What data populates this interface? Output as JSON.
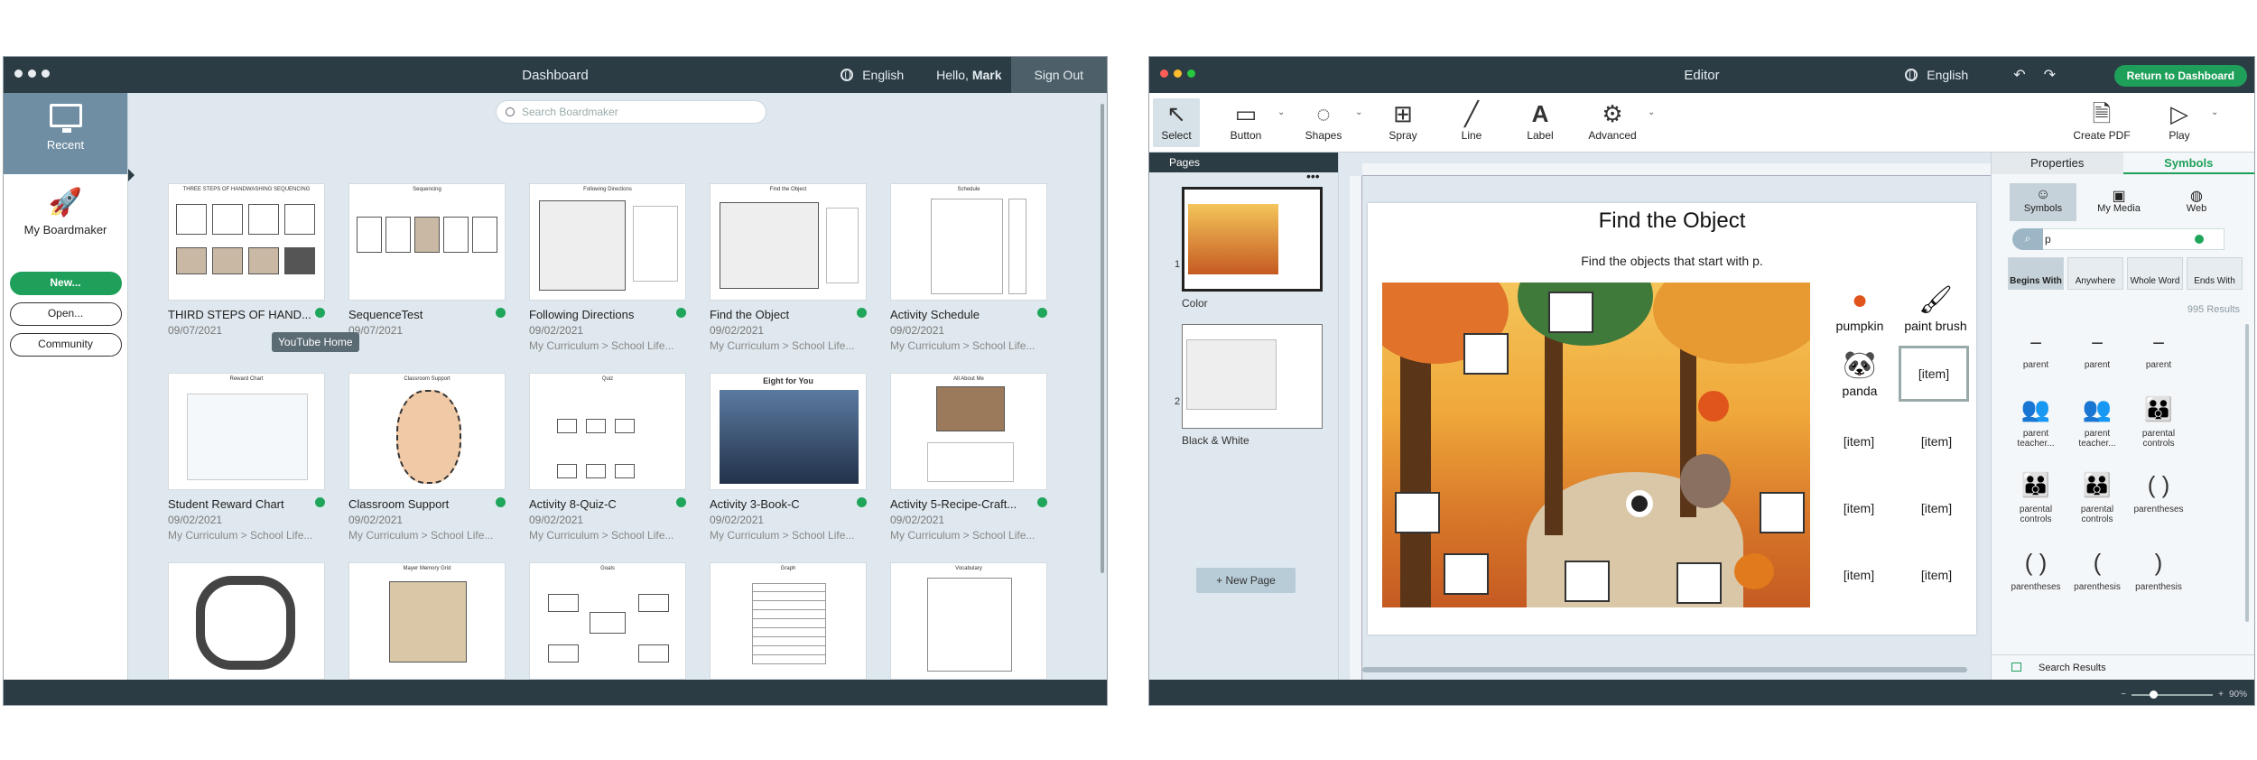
{
  "dashboard": {
    "title": "Dashboard",
    "language": "English",
    "greeting": "Hello,",
    "user": "Mark",
    "sign_out": "Sign Out",
    "search_placeholder": "Search Boardmaker",
    "sidebar": {
      "recent": "Recent",
      "my_boardmaker": "My Boardmaker",
      "new": "New...",
      "open": "Open...",
      "community": "Community"
    },
    "tooltip": "YouTube Home",
    "cards": [
      {
        "name": "THIRD STEPS OF HAND...",
        "date": "09/07/2021",
        "path": "",
        "thumb_title": "THREE STEPS OF HANDWASHING SEQUENCING"
      },
      {
        "name": "SequenceTest",
        "date": "09/07/2021",
        "path": "",
        "thumb_title": "Sequencing"
      },
      {
        "name": "Following Directions",
        "date": "09/02/2021",
        "path": "My Curriculum > School Life...",
        "thumb_title": "Following Directions"
      },
      {
        "name": "Find the Object",
        "date": "09/02/2021",
        "path": "My Curriculum > School Life...",
        "thumb_title": "Find the Object"
      },
      {
        "name": "Activity Schedule",
        "date": "09/02/2021",
        "path": "My Curriculum > School Life...",
        "thumb_title": "Schedule"
      },
      {
        "name": "Student Reward Chart",
        "date": "09/02/2021",
        "path": "My Curriculum > School Life...",
        "thumb_title": "Reward Chart"
      },
      {
        "name": "Classroom Support",
        "date": "09/02/2021",
        "path": "My Curriculum > School Life...",
        "thumb_title": "Classroom Support"
      },
      {
        "name": "Activity 8-Quiz-C",
        "date": "09/02/2021",
        "path": "My Curriculum > School Life...",
        "thumb_title": "Quiz"
      },
      {
        "name": "Activity 3-Book-C",
        "date": "09/02/2021",
        "path": "My Curriculum > School Life...",
        "thumb_title": "Eight for You"
      },
      {
        "name": "Activity 5-Recipe-Craft...",
        "date": "09/02/2021",
        "path": "My Curriculum > School Life...",
        "thumb_title": "All About Me"
      },
      {
        "name": "",
        "date": "",
        "path": "",
        "thumb_title": ""
      },
      {
        "name": "",
        "date": "",
        "path": "",
        "thumb_title": "Mayer Memory Grid"
      },
      {
        "name": "",
        "date": "",
        "path": "",
        "thumb_title": "Goals"
      },
      {
        "name": "",
        "date": "",
        "path": "",
        "thumb_title": "Graph"
      },
      {
        "name": "",
        "date": "",
        "path": "",
        "thumb_title": "Vocabulary"
      }
    ]
  },
  "editor": {
    "title": "Editor",
    "language": "English",
    "return": "Return to Dashboard",
    "tools": {
      "select": "Select",
      "button": "Button",
      "shapes": "Shapes",
      "spray": "Spray",
      "line": "Line",
      "label": "Label",
      "advanced": "Advanced",
      "create_pdf": "Create PDF",
      "play": "Play"
    },
    "pages_header": "Pages",
    "pages": [
      {
        "num": "1",
        "label": "Color"
      },
      {
        "num": "2",
        "label": "Black & White"
      }
    ],
    "new_page": "+ New Page",
    "canvas": {
      "title": "Find the Object",
      "subtitle": "Find the objects that start with p.",
      "symbols": [
        "pumpkin",
        "paint brush",
        "panda"
      ],
      "item_label": "[item]"
    },
    "properties": {
      "tab_properties": "Properties",
      "tab_symbols": "Symbols",
      "sources": [
        "Symbols",
        "My Media",
        "Web"
      ],
      "query": "p",
      "filters": [
        "Begins With",
        "Anywhere",
        "Whole Word",
        "Ends With"
      ],
      "results": "995 Results",
      "symbols": [
        "parent",
        "parent",
        "parent",
        "parent teacher...",
        "parent teacher...",
        "parental controls",
        "parental controls",
        "parental controls",
        "parentheses",
        "parentheses",
        "parenthesis",
        "parenthesis"
      ],
      "search_results": "Search Results",
      "zoom": "90%"
    }
  }
}
